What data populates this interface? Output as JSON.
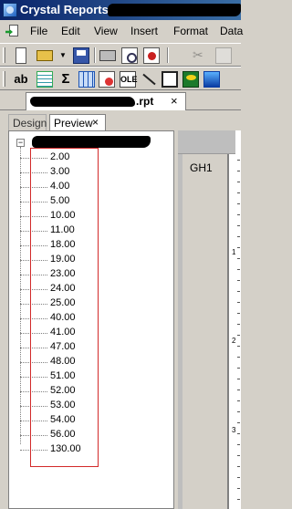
{
  "window": {
    "title": "Crystal Reports"
  },
  "menu": {
    "items": [
      "File",
      "Edit",
      "View",
      "Insert",
      "Format",
      "Data"
    ]
  },
  "toolbar1": {
    "buttons": [
      "new-icon",
      "open-icon",
      "dropdown-arrow",
      "save-icon",
      "print-icon",
      "print-preview-icon",
      "export-icon",
      "cut-icon",
      "copy-icon"
    ]
  },
  "toolbar2": {
    "field_glyph": "ab",
    "sum_glyph": "Σ",
    "ole_glyph": "OLE",
    "buttons": [
      "insert-field-icon",
      "insert-group-icon",
      "insert-summary-icon",
      "insert-crosstab-icon",
      "insert-subreport-icon",
      "insert-ole-icon",
      "draw-line-icon",
      "draw-box-icon",
      "insert-chart-icon",
      "insert-map-icon"
    ]
  },
  "doc_tab": {
    "filename_suffix": ".rpt",
    "close": "×"
  },
  "view_tabs": {
    "design": "Design",
    "preview": "Preview",
    "close": "×"
  },
  "tree": {
    "root_toggle": "−",
    "items": [
      "2.00",
      "3.00",
      "4.00",
      "5.00",
      "10.00",
      "11.00",
      "18.00",
      "19.00",
      "23.00",
      "24.00",
      "25.00",
      "40.00",
      "41.00",
      "47.00",
      "48.00",
      "51.00",
      "52.00",
      "53.00",
      "54.00",
      "56.00",
      "130.00"
    ]
  },
  "report": {
    "section_label": "GH1",
    "ruler_numbers": [
      "1",
      "2",
      "3"
    ]
  },
  "colors": {
    "titlebar_start": "#0a246a",
    "titlebar_end": "#3a6ea5",
    "highlight_box": "#d22a2a"
  }
}
